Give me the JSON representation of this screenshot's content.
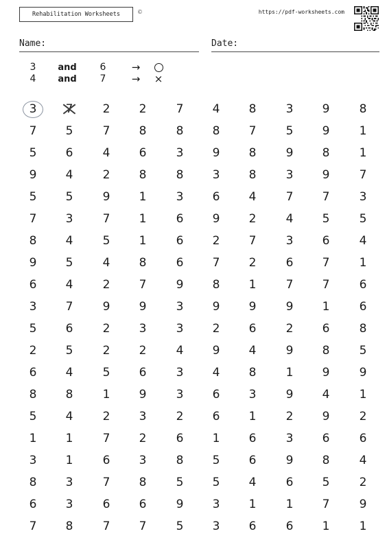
{
  "header": {
    "brand_title": "Rehabilitation Worksheets",
    "copyright_symbol": "©",
    "site_url": "https://pdf-worksheets.com",
    "qr_code_icon": "qr-code-icon"
  },
  "fields": {
    "name_label": "Name:",
    "date_label": "Date:"
  },
  "legend": {
    "rows": [
      {
        "number_a": "3",
        "conjunction": "and",
        "number_b": "6",
        "arrow": "→",
        "symbol": "circle",
        "symbol_char": "○"
      },
      {
        "number_a": "4",
        "conjunction": "and",
        "number_b": "7",
        "arrow": "→",
        "symbol": "cross",
        "symbol_char": "×"
      }
    ]
  },
  "grids": {
    "left": {
      "rows": [
        [
          "3",
          "7",
          "2",
          "2",
          "7"
        ],
        [
          "7",
          "5",
          "7",
          "8",
          "8"
        ],
        [
          "5",
          "6",
          "4",
          "6",
          "3"
        ],
        [
          "9",
          "4",
          "2",
          "8",
          "8"
        ],
        [
          "5",
          "5",
          "9",
          "1",
          "3"
        ],
        [
          "7",
          "3",
          "7",
          "1",
          "6"
        ],
        [
          "8",
          "4",
          "5",
          "1",
          "6"
        ],
        [
          "9",
          "5",
          "4",
          "8",
          "6"
        ],
        [
          "6",
          "4",
          "2",
          "7",
          "9"
        ],
        [
          "3",
          "7",
          "9",
          "9",
          "3"
        ],
        [
          "5",
          "6",
          "2",
          "3",
          "3"
        ],
        [
          "2",
          "5",
          "2",
          "2",
          "4"
        ],
        [
          "6",
          "4",
          "5",
          "6",
          "3"
        ],
        [
          "8",
          "8",
          "1",
          "9",
          "3"
        ],
        [
          "5",
          "4",
          "2",
          "3",
          "2"
        ],
        [
          "1",
          "1",
          "7",
          "2",
          "6"
        ],
        [
          "3",
          "1",
          "6",
          "3",
          "8"
        ],
        [
          "8",
          "3",
          "7",
          "8",
          "5"
        ],
        [
          "6",
          "3",
          "6",
          "6",
          "9"
        ],
        [
          "7",
          "8",
          "7",
          "7",
          "5"
        ]
      ],
      "marks": [
        {
          "row": 0,
          "col": 0,
          "type": "circle"
        },
        {
          "row": 0,
          "col": 1,
          "type": "cross"
        }
      ]
    },
    "right": {
      "rows": [
        [
          "4",
          "8",
          "3",
          "9",
          "8"
        ],
        [
          "8",
          "7",
          "5",
          "9",
          "1"
        ],
        [
          "9",
          "8",
          "9",
          "8",
          "1"
        ],
        [
          "3",
          "8",
          "3",
          "9",
          "7"
        ],
        [
          "6",
          "4",
          "7",
          "7",
          "3"
        ],
        [
          "9",
          "2",
          "4",
          "5",
          "5"
        ],
        [
          "2",
          "7",
          "3",
          "6",
          "4"
        ],
        [
          "7",
          "2",
          "6",
          "7",
          "1"
        ],
        [
          "8",
          "1",
          "7",
          "7",
          "6"
        ],
        [
          "9",
          "9",
          "9",
          "1",
          "6"
        ],
        [
          "2",
          "6",
          "2",
          "6",
          "8"
        ],
        [
          "9",
          "4",
          "9",
          "8",
          "5"
        ],
        [
          "4",
          "8",
          "1",
          "9",
          "9"
        ],
        [
          "6",
          "3",
          "9",
          "4",
          "1"
        ],
        [
          "6",
          "1",
          "2",
          "9",
          "2"
        ],
        [
          "1",
          "6",
          "3",
          "6",
          "6"
        ],
        [
          "5",
          "6",
          "9",
          "8",
          "4"
        ],
        [
          "5",
          "4",
          "6",
          "5",
          "2"
        ],
        [
          "3",
          "1",
          "1",
          "7",
          "9"
        ],
        [
          "3",
          "6",
          "6",
          "1",
          "1"
        ]
      ],
      "marks": []
    }
  }
}
